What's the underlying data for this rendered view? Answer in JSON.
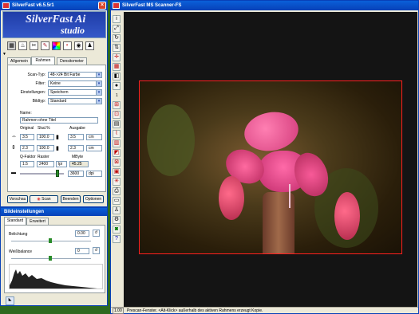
{
  "left_window": {
    "title": "SilverFast v6.5.5r1",
    "logo_top": "SilverFast Ai",
    "logo_bottom": "studio",
    "tabs": [
      "Allgemein",
      "Rahmen",
      "Densitometer"
    ],
    "labels": {
      "scan_type": "Scan-Typ:",
      "filter": "Filter:",
      "settings": "Einstellungen:",
      "image_type": "Bildtyp:",
      "name": "Name:",
      "original": "Original",
      "scale": "Skal.%",
      "output": "Ausgabe",
      "q_factor": "Q-Faktor",
      "raster": "Raster",
      "mbyte": "MByte"
    },
    "values": {
      "scan_type": "48->24 Bit Farbe",
      "filter": "Keine",
      "settings": "Speichern",
      "image_type": "Standard",
      "name": "Rahmen ohne Titel",
      "orig_w": "3.5",
      "scale_w": "100.0",
      "out_w": "3.5",
      "unit_w": "cm",
      "orig_h": "2.3",
      "scale_h": "100.0",
      "out_h": "2.3",
      "unit_h": "cm",
      "q_factor": "1.5",
      "raster": "2400",
      "raster_unit": "lpi",
      "mbyte": "45.25",
      "resolution": "3600",
      "res_unit": "dpi"
    },
    "buttons": {
      "preview": "Vorschau",
      "scan": "Scan",
      "quit": "Beenden",
      "options": "Optionen"
    }
  },
  "image_settings": {
    "title": "Bildeinstellungen",
    "tabs": [
      "Standard",
      "Erweitert"
    ],
    "exposure_label": "Belichtung",
    "exposure_value": "0.00",
    "whitebalance_label": "Weißbalance",
    "whitebalance_value": "0"
  },
  "scanner_window": {
    "title": "SilverFast  MS Scanner-FS",
    "zoom": "1",
    "status_left": "1.00",
    "status_text": "Prescan-Fenster. <Alt-Klick> außerhalb des aktiven Rahmens erzeugt Kopie."
  },
  "colors": {
    "desktop": "#2e6a1f",
    "titlebar": "#0841b8",
    "frame": "#ff2020",
    "preview_bg": "#141414"
  },
  "icons": [
    "grid-icon",
    "fire-icon",
    "cut-icon",
    "palette-icon",
    "lab-icon",
    "eye-icon",
    "figure-icon"
  ]
}
